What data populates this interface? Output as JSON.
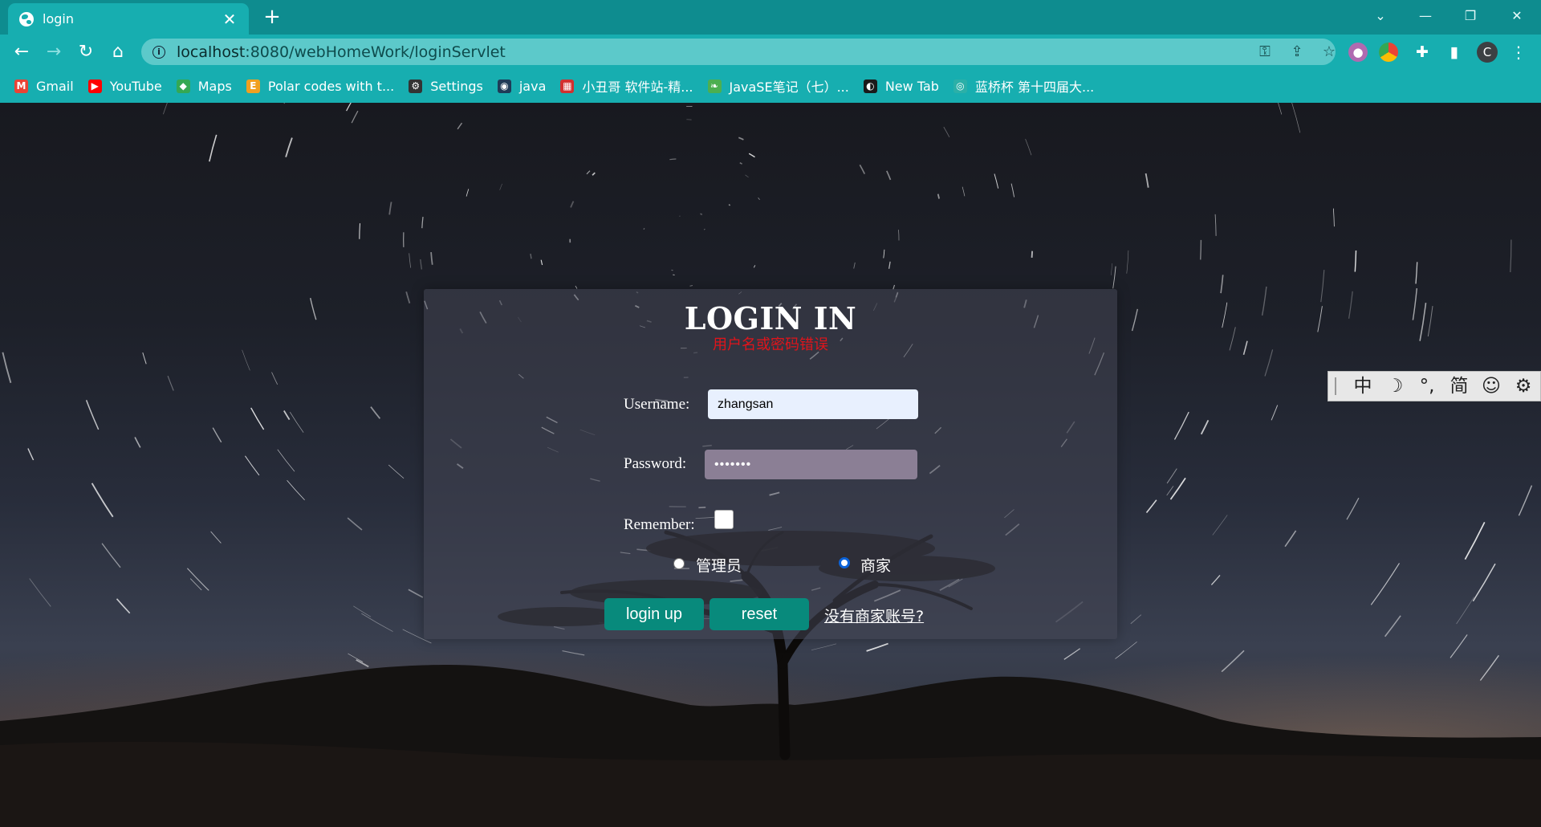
{
  "browser": {
    "tab_title": "login",
    "tab_close": "✕",
    "new_tab": "+",
    "url_host": "localhost",
    "url_path": ":8080/webHomeWork/loginServlet",
    "profile_initial": "C",
    "window_controls": [
      "⌄",
      "—",
      "❐",
      "✕"
    ],
    "bookmarks": [
      {
        "label": "Gmail",
        "icon": "gmail-icon",
        "color": "#ea4335",
        "glyph": "M"
      },
      {
        "label": "YouTube",
        "icon": "youtube-icon",
        "color": "#ff0000",
        "glyph": "▶"
      },
      {
        "label": "Maps",
        "icon": "maps-icon",
        "color": "#34a853",
        "glyph": "◆"
      },
      {
        "label": "Polar codes with t...",
        "icon": "e-icon",
        "color": "#f0a020",
        "glyph": "E"
      },
      {
        "label": "Settings",
        "icon": "gear-icon",
        "color": "#333333",
        "glyph": "⚙"
      },
      {
        "label": "java",
        "icon": "java-icon",
        "color": "#1f3b57",
        "glyph": "◉"
      },
      {
        "label": "小丑哥 软件站-精...",
        "icon": "software-icon",
        "color": "#d32f2f",
        "glyph": "▦"
      },
      {
        "label": "JavaSE笔记（七）...",
        "icon": "leaf-icon",
        "color": "#4caf50",
        "glyph": "❧"
      },
      {
        "label": "New Tab",
        "icon": "globe-icon",
        "color": "#1a1a1a",
        "glyph": "◐"
      },
      {
        "label": "蓝桥杯 第十四届大...",
        "icon": "lanqiao-icon",
        "color": "#2bb0a8",
        "glyph": "◎"
      }
    ]
  },
  "login": {
    "title": "LOGIN IN",
    "error": "用户名或密码错误",
    "username_label": "Username:",
    "username_value": "zhangsan",
    "password_label": "Password:",
    "password_value": "•••••••",
    "remember_label": "Remember:",
    "remember_checked": false,
    "roles": [
      {
        "label": "管理员",
        "selected": false
      },
      {
        "label": "商家",
        "selected": true
      }
    ],
    "login_button": "login up",
    "reset_button": "reset",
    "register_link": "没有商家账号? "
  },
  "ime_toolbar": {
    "items": [
      "中",
      "☽",
      "°,",
      "简",
      "☺",
      "⚙"
    ]
  },
  "colors": {
    "chrome": "#17aeb0",
    "titlebar": "#0e8c8f",
    "button": "#088a7c",
    "error": "#e0141b"
  }
}
